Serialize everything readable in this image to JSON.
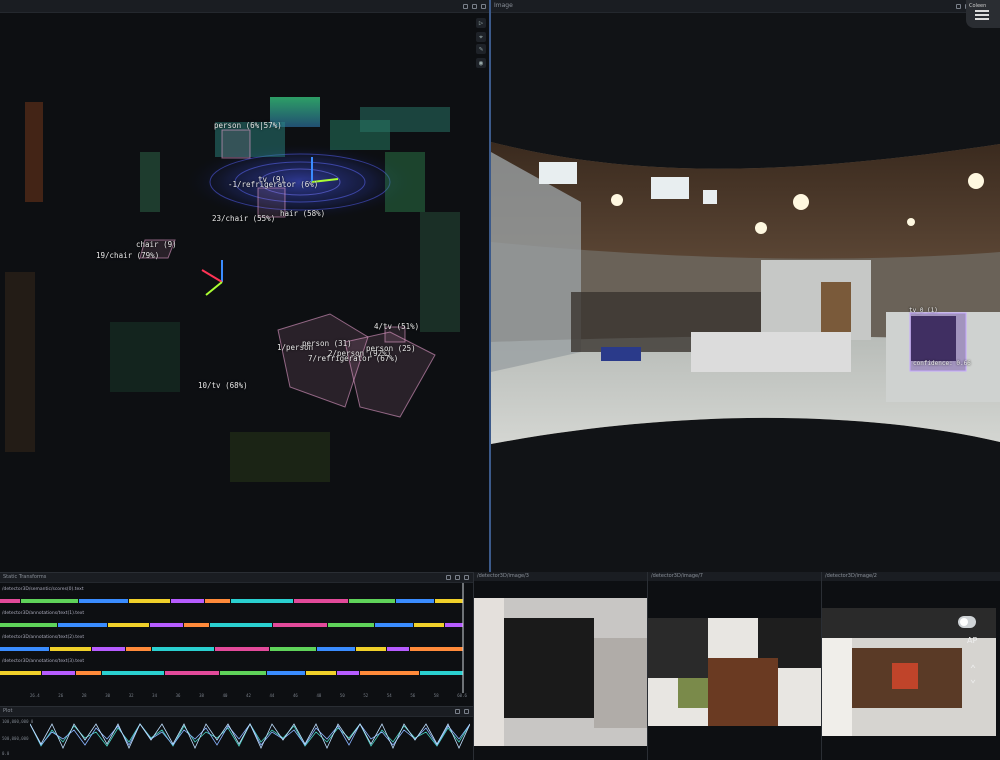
{
  "viewer3d": {
    "title": "",
    "labels": {
      "l1": "person (6%|57%)",
      "l2": "tv (9)",
      "l3": "-1/refrigerator (6%)",
      "l4": "23/chair (55%)",
      "l5": "hair (58%)",
      "l6": "chair (9)",
      "l7": "19/chair (79%)",
      "l8": "4/tv (51%)",
      "l9": "1/person",
      "l10": "person (31)",
      "l11": "2/person (92%)",
      "l12": "person (25)",
      "l13": "7/refrigerator (67%)",
      "l14": "10/tv (68%)"
    }
  },
  "image_panel": {
    "title": "Image",
    "det1": "tv_0 (1)",
    "det2": "confidence: 0.66"
  },
  "corner": {
    "label": "Coleen"
  },
  "timeline": {
    "title": "Static Transforms",
    "rows": [
      "/detector3D/semantic/scores(0).text",
      "/detector3D/annotations/text(1).text",
      "/detector3D/annotations/text(2).text",
      "/detector3D/annotations/text(3).text"
    ],
    "ticks": [
      "26.4",
      "26",
      "28",
      "30",
      "32",
      "34",
      "36",
      "38",
      "40",
      "42",
      "44",
      "46",
      "48",
      "50",
      "52",
      "54",
      "56",
      "58",
      "60.6"
    ]
  },
  "plot": {
    "title": "Plot",
    "y_labels": [
      "100,000,000  0",
      "500,000,000",
      "0.0"
    ]
  },
  "thumbs": [
    {
      "title": "/detector3D/image/3"
    },
    {
      "title": "/detector3D/image/7"
    },
    {
      "title": "/detector3D/image/2"
    }
  ],
  "overlay": {
    "ap": "AP"
  },
  "colors": {
    "bg": "#0d0f12",
    "header": "#1a1d22",
    "accent": "#f4a7d9"
  }
}
